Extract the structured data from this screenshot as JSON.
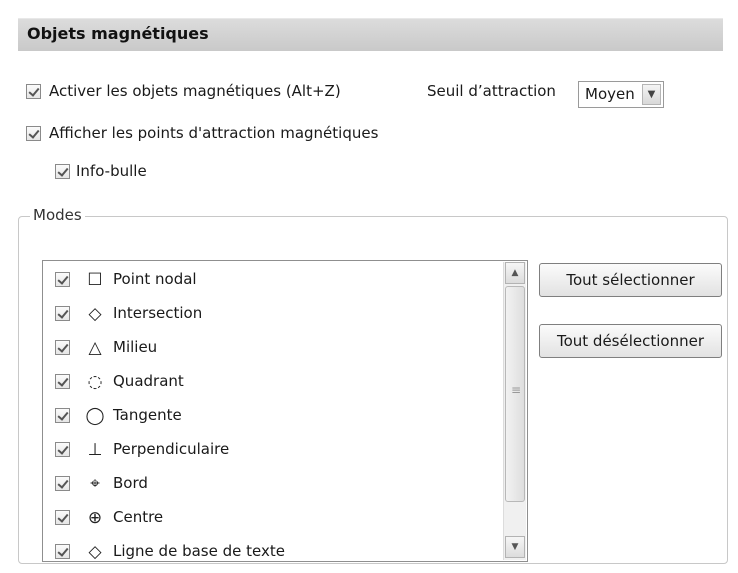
{
  "section": {
    "title": "Objets magnétiques"
  },
  "options": {
    "enable_magnetic": {
      "label": "Activer les objets magnétiques (Alt+Z)",
      "checked": true
    },
    "show_points": {
      "label": "Afficher les points d'attraction magnétiques",
      "checked": true
    },
    "tooltip": {
      "label": "Info-bulle",
      "checked": true
    }
  },
  "threshold": {
    "label": "Seuil d’attraction",
    "value": "Moyen"
  },
  "modes": {
    "title": "Modes",
    "items": [
      {
        "label": "Point nodal",
        "icon": "square-icon",
        "glyph": "☐",
        "checked": true
      },
      {
        "label": "Intersection",
        "icon": "diamond-icon",
        "glyph": "◇",
        "checked": true
      },
      {
        "label": "Milieu",
        "icon": "triangle-icon",
        "glyph": "△",
        "checked": true
      },
      {
        "label": "Quadrant",
        "icon": "quadrant-icon",
        "glyph": "◌",
        "checked": true
      },
      {
        "label": "Tangente",
        "icon": "tangent-icon",
        "glyph": "◯",
        "checked": true
      },
      {
        "label": "Perpendiculaire",
        "icon": "perpendicular-icon",
        "glyph": "⊥",
        "checked": true
      },
      {
        "label": "Bord",
        "icon": "edge-icon",
        "glyph": "⌖",
        "checked": true
      },
      {
        "label": "Centre",
        "icon": "center-icon",
        "glyph": "⊕",
        "checked": true
      },
      {
        "label": "Ligne de base de texte",
        "icon": "baseline-icon",
        "glyph": "◇",
        "checked": true
      }
    ],
    "select_all": "Tout sélectionner",
    "deselect_all": "Tout désélectionner"
  }
}
